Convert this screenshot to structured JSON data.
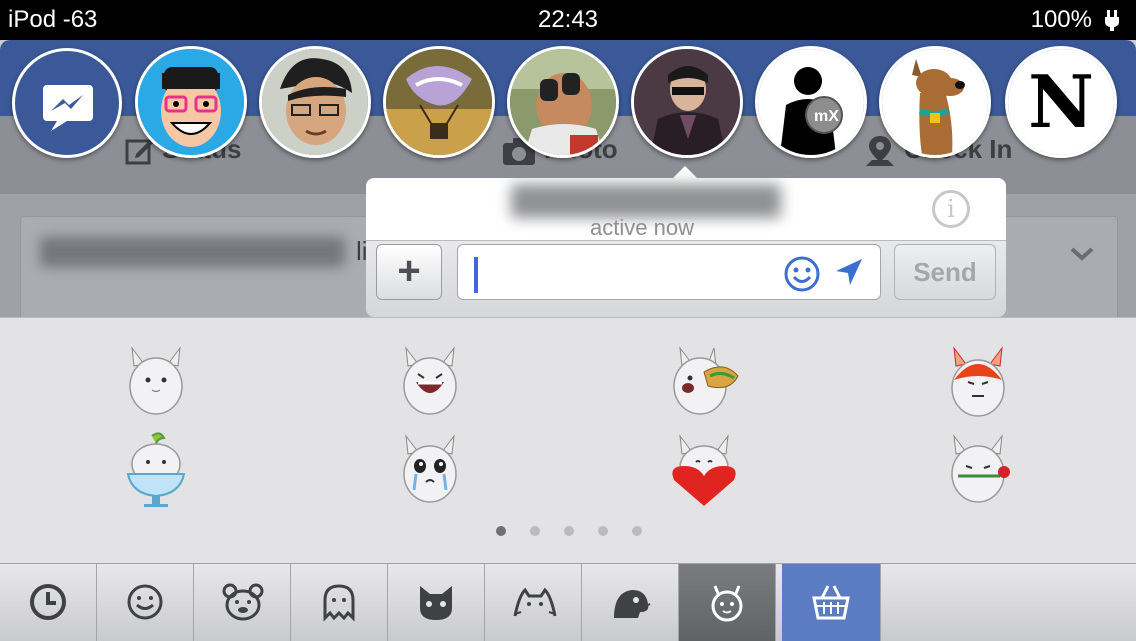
{
  "status_bar": {
    "carrier": "iPod -63",
    "time": "22:43",
    "battery": "100%",
    "charging_icon": "plug-icon"
  },
  "background_app": {
    "actions": [
      {
        "label": "Status",
        "icon": "compose-icon"
      },
      {
        "label": "Photo",
        "icon": "camera-icon"
      },
      {
        "label": "Check In",
        "icon": "location-pin-icon"
      }
    ],
    "feed_text_suffix": "li"
  },
  "chat_heads": {
    "messenger_icon": "messenger-icon",
    "avatars": [
      "cartoon-glasses-man",
      "man-squinting",
      "balloon-photo",
      "man-with-binoculars",
      "man-with-sunglasses",
      "silhouette-mx-logo",
      "cartoon-dog",
      "gothic-letter-n"
    ],
    "gothic_letter": "N"
  },
  "chat_popup": {
    "status": "active now",
    "info_icon_label": "i",
    "add_label": "+",
    "input_value": "",
    "send_label": "Send"
  },
  "stickers": {
    "items": [
      "bunny-neutral",
      "bunny-laughing",
      "bunny-taco",
      "bunny-angry",
      "bunny-in-cup",
      "bunny-crying",
      "bunny-heart",
      "bunny-rose"
    ],
    "page_count": 5,
    "current_page": 1
  },
  "tabbar": {
    "tabs": [
      "recent-clock-icon",
      "smiley-icon",
      "bear-icon",
      "ghost-icon",
      "cat-icon",
      "pusheen-cat-icon",
      "dinosaur-icon",
      "horned-bunny-icon",
      "sticker-store-basket-icon"
    ],
    "selected_index": 7,
    "accent": "#5b7cc2"
  },
  "colors": {
    "facebook_blue": "#3b5998",
    "input_caret": "#4466dd"
  }
}
